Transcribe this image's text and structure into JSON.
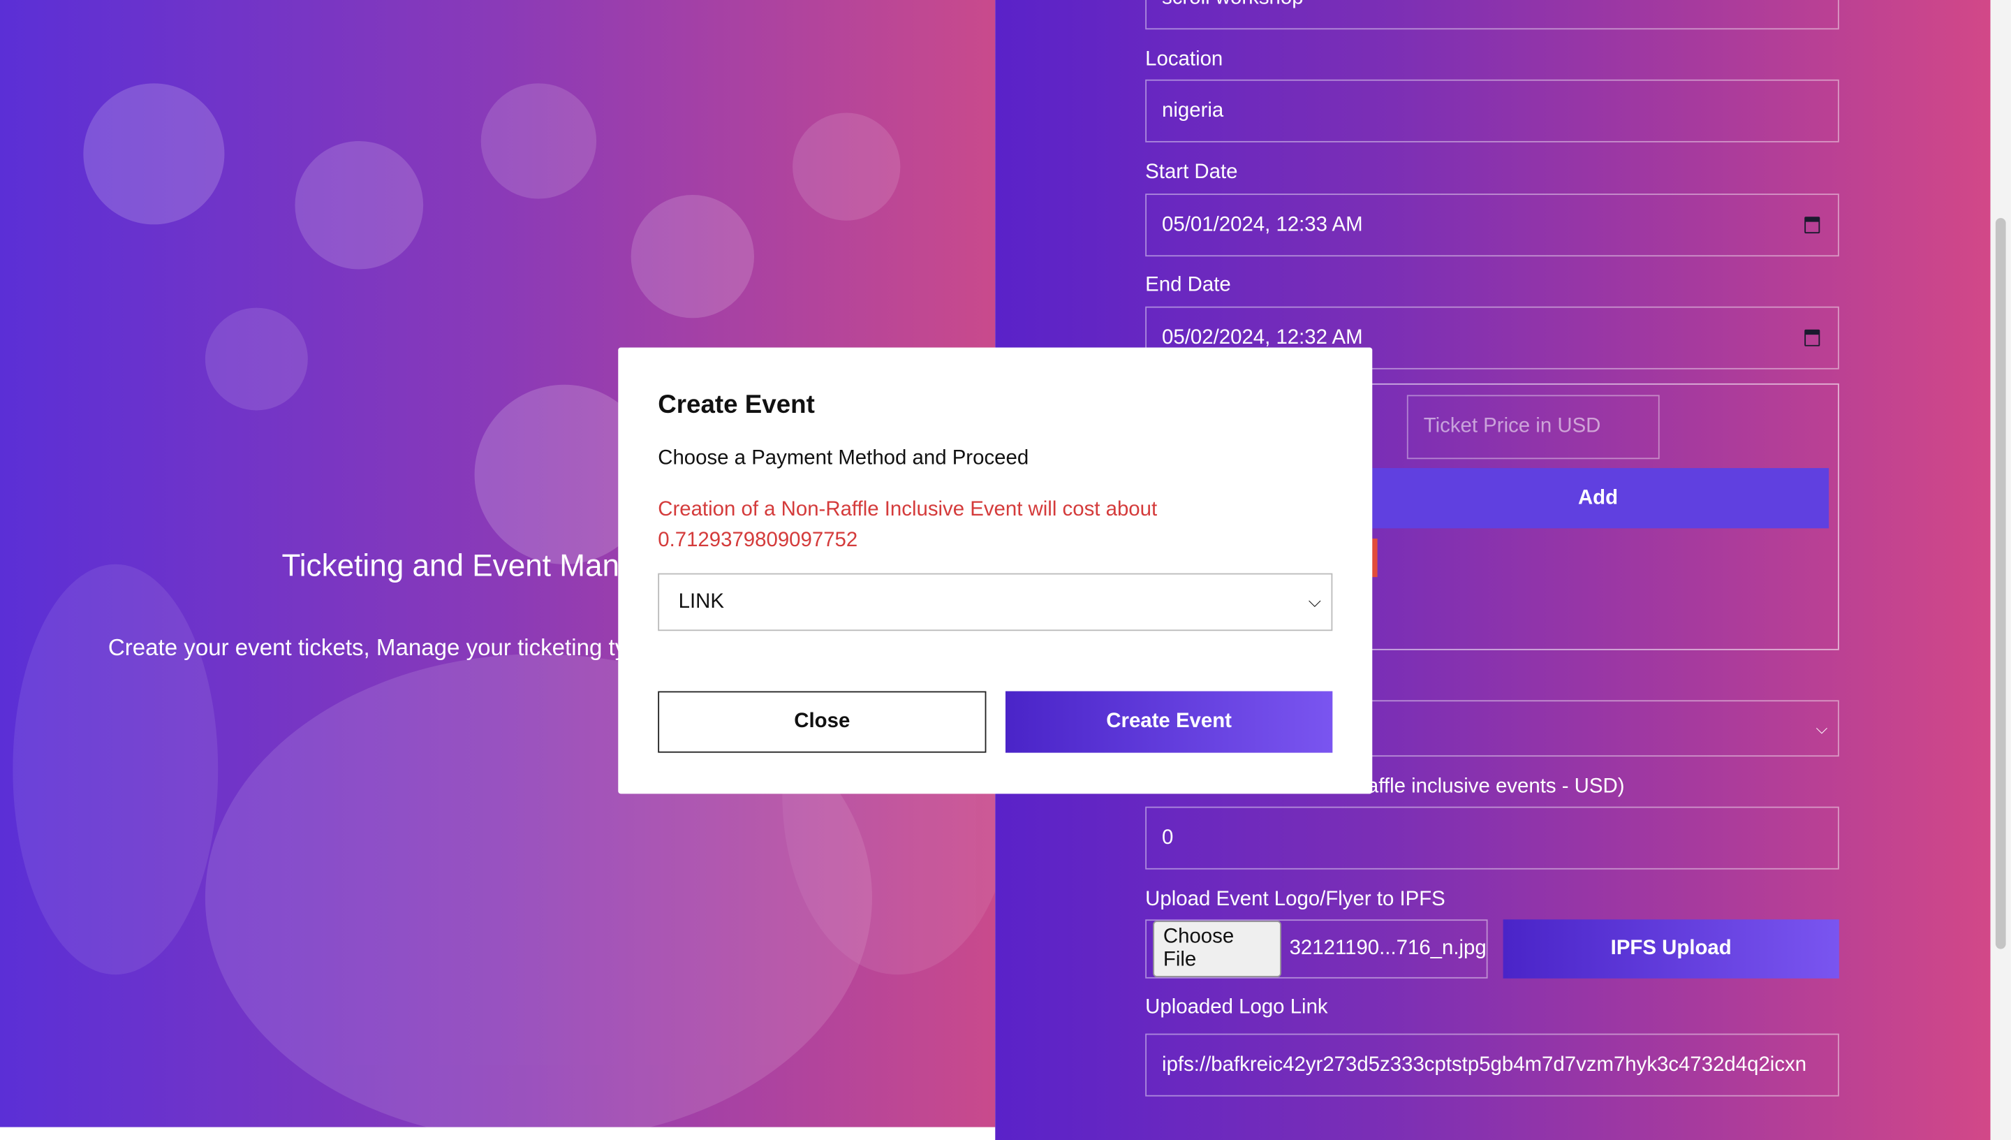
{
  "hero": {
    "title": "Ticketing and Event Manageme",
    "description": "Create your event tickets, Manage your ticketing typ engage in lottery game."
  },
  "form": {
    "event_name_value": "scroll workshop",
    "location_label": "Location",
    "location_value": "nigeria",
    "start_date_label": "Start Date",
    "start_date_value": "05/01/2024, 12:33 AM",
    "end_date_label": "End Date",
    "end_date_value": "05/02/2024, 12:32 AM",
    "ticket_price_placeholder": "Ticket Price in USD",
    "add_label": "Add",
    "raffle_label": "affle inclusive events - USD)",
    "raffle_value": "0",
    "upload_label": "Upload Event Logo/Flyer to IPFS",
    "choose_file_label": "Choose File",
    "file_name": "32121190...716_n.jpg",
    "ipfs_upload_label": "IPFS Upload",
    "uploaded_link_label": "Uploaded Logo Link",
    "uploaded_link_value": "ipfs://bafkreic42yr273d5z333cptstp5gb4m7d7vzm7hyk3c4732d4q2icxn"
  },
  "modal": {
    "title": "Create Event",
    "subtitle": "Choose a Payment Method and Proceed",
    "warning": "Creation of a Non-Raffle Inclusive Event will cost about 0.7129379809097752",
    "payment_selected": "LINK",
    "close_label": "Close",
    "create_label": "Create Event"
  },
  "colors": {
    "accent": "#6040e0",
    "warning": "#d43b3b"
  }
}
